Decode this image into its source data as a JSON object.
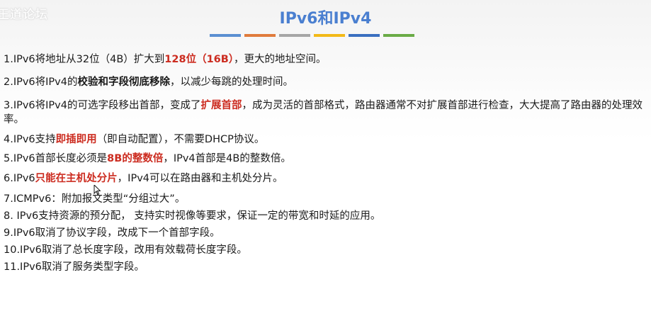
{
  "watermark": "王道论坛",
  "title": "IPv6和IPv4",
  "color_bar": [
    "#5b8fd1",
    "#e07b3c",
    "#a5a5a5",
    "#f2b918",
    "#3a6fc0",
    "#6aab46"
  ],
  "items": [
    {
      "pre": "1.IPv6将地址从32位（4B）扩大到",
      "hl": "128位（16B）",
      "post": "，更大的地址空间。"
    },
    {
      "pre": "2.IPv6将IPv4的",
      "bold": "校验和字段彻底移除",
      "post": "，以减少每跳的处理时间。"
    },
    {
      "pre": "3.IPv6将IPv4的可选字段移出首部，变成了",
      "hl": "扩展首部",
      "post": "，成为灵活的首部格式，路由器通常不对扩展首部进行检查，大大提高了路由器的处理效率。"
    },
    {
      "pre": "4.IPv6支持",
      "hl": "即插即用",
      "post": "（即自动配置），不需要DHCP协议。"
    },
    {
      "pre": "5.IPv6首部长度必须是",
      "hl": "8B的整数倍",
      "post": "，IPv4首部是4B的整数倍。"
    },
    {
      "pre": "6.IPv6",
      "hl": "只能在主机处分片",
      "post": "，IPv4可以在路由器和主机处分片。"
    },
    {
      "pre": "7.ICMPv6：附加报文类型“分组过大”。"
    },
    {
      "pre": "8. IPv6支持资源的预分配， 支持实时视像等要求，保证一定的带宽和时延的应用。"
    },
    {
      "pre": "9.IPv6取消了协议字段，改成下一个首部字段。"
    },
    {
      "pre": "10.IPv6取消了总长度字段，改用有效载荷长度字段。"
    },
    {
      "pre": "11.IPv6取消了服务类型字段。"
    }
  ]
}
